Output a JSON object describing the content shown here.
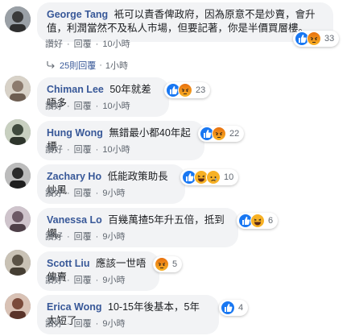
{
  "comments": [
    {
      "name": "George Tang",
      "text_line1": "衹可以責香俾政府，因為原意不是炒賣，會升",
      "text_line2": "值，利潤當然不及私人市場，但要記著，你是半價買層樓。",
      "reaction_count": "33",
      "like": "讚好",
      "reply": "回覆",
      "time": "10小時",
      "avatar_color": "#5a5a5a"
    },
    {
      "name": "Chiman Lee",
      "text": "50年就差唔多",
      "reaction_count": "23",
      "like": "讚好",
      "reply": "回覆",
      "time": "10小時",
      "avatar_color": "#8c7b6e"
    },
    {
      "name": "Hung Wong",
      "text": "無錯最小都40年起標",
      "reaction_count": "22",
      "like": "讚好",
      "reply": "回覆",
      "time": "10小時",
      "avatar_color": "#3f4a3d"
    },
    {
      "name": "Zachary Ho",
      "text": "低能政策助長炒風",
      "reaction_count": "10",
      "like": "讚好",
      "reply": "回覆",
      "time": "9小時",
      "avatar_color": "#3a3a3a"
    },
    {
      "name": "Vanessa Lo",
      "text": "百幾萬揸5年升五倍，抵到爛。",
      "reaction_count": "6",
      "like": "讚好",
      "reply": "回覆",
      "time": "9小時",
      "avatar_color": "#6d5a66"
    },
    {
      "name": "Scott Liu",
      "text": "應該一世唔俾賣",
      "reaction_count": "5",
      "like": "讚好",
      "reply": "回覆",
      "time": "9小時",
      "avatar_color": "#5b5346"
    },
    {
      "name": "Erica Wong",
      "text": "10-15年後基本，5年太短了",
      "reaction_count": "4",
      "like": "讚好",
      "reply": "回覆",
      "time": "9小時",
      "avatar_color": "#7a4a3a"
    }
  ],
  "replies_summary": {
    "text": "25則回覆",
    "time": "1小時"
  },
  "colors": {
    "name_link": "#385898",
    "bubble_bg": "#f2f3f5",
    "meta_text": "#606770",
    "like_blue": "#1877f2",
    "angry_orange": "#e9710f"
  }
}
